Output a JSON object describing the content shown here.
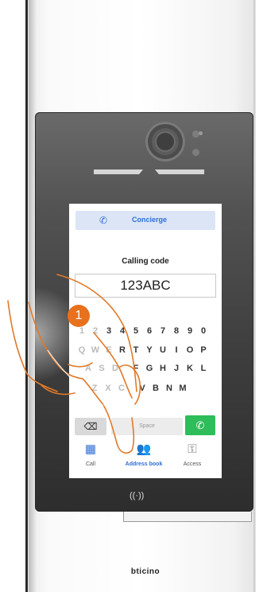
{
  "device": {
    "brand": "bticino",
    "nfc_symbol": "((·))"
  },
  "screen": {
    "concierge_label": "Concierge",
    "calling_code_title": "Calling code",
    "code_value": "123ABC",
    "keyboard": {
      "row1": [
        "1",
        "2",
        "3",
        "4",
        "5",
        "6",
        "7",
        "8",
        "9",
        "0"
      ],
      "row2": [
        "Q",
        "W",
        "E",
        "R",
        "T",
        "Y",
        "U",
        "I",
        "O",
        "P"
      ],
      "row3": [
        "A",
        "S",
        "D",
        "F",
        "G",
        "H",
        "J",
        "K",
        "L"
      ],
      "row4": [
        "Z",
        "X",
        "C",
        "V",
        "B",
        "N",
        "M"
      ],
      "space_label": "Space"
    },
    "nav": {
      "call_label": "Call",
      "address_book_label": "Address book",
      "access_label": "Access"
    }
  },
  "annotation": {
    "step_number": "1"
  },
  "colors": {
    "accent": "#2f6ed6",
    "call_green": "#2ebd5a",
    "callout_orange": "#e8711e",
    "hand_outline": "#e07a2a"
  }
}
